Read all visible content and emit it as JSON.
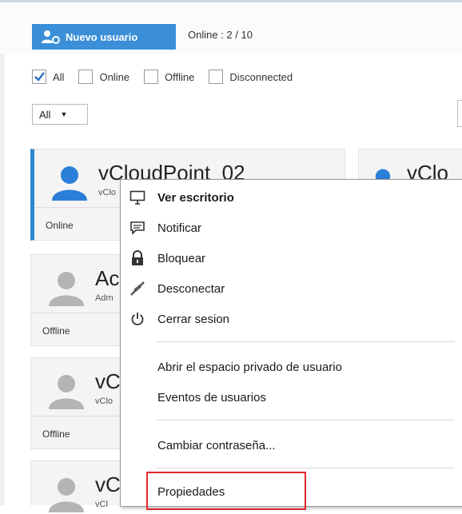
{
  "toolbar": {
    "new_user_label": "Nuevo usuario",
    "online_count": "Online : 2 / 10"
  },
  "filters": [
    {
      "label": "All",
      "checked": true
    },
    {
      "label": "Online",
      "checked": false
    },
    {
      "label": "Offline",
      "checked": false
    },
    {
      "label": "Disconnected",
      "checked": false
    }
  ],
  "group_select": {
    "value": "All"
  },
  "cards": [
    {
      "name": "vCloudPoint_02",
      "sub": "vClo",
      "status": "Online",
      "avatar_color": "#2b7fd8"
    },
    {
      "name": "Ac",
      "sub": "Adm",
      "status": "Offline",
      "avatar_color": "#b4b4b4"
    },
    {
      "name": "vC",
      "sub": "vClo",
      "status": "Offline",
      "avatar_color": "#b4b4b4"
    },
    {
      "name": "vC",
      "sub": "vCl",
      "status": "",
      "avatar_color": "#b4b4b4"
    }
  ],
  "card_right": {
    "name": "vClo",
    "avatar_color": "#2b7fd8"
  },
  "context_menu": {
    "items": [
      {
        "label": "Ver escritorio",
        "icon": "monitor-icon",
        "bold": true
      },
      {
        "label": "Notificar",
        "icon": "message-icon"
      },
      {
        "label": "Bloquear",
        "icon": "lock-icon"
      },
      {
        "label": "Desconectar",
        "icon": "disconnect-icon"
      },
      {
        "label": "Cerrar sesion",
        "icon": "power-icon"
      },
      {
        "label": "Abrir el espacio privado de usuario"
      },
      {
        "label": "Eventos de usuarios"
      },
      {
        "label": "Cambiar contraseña..."
      },
      {
        "label": "Propiedades"
      }
    ]
  },
  "colors": {
    "accent": "#3a8fd8",
    "highlight_border": "#e0262b",
    "active_bar": "#2b8ad6"
  }
}
